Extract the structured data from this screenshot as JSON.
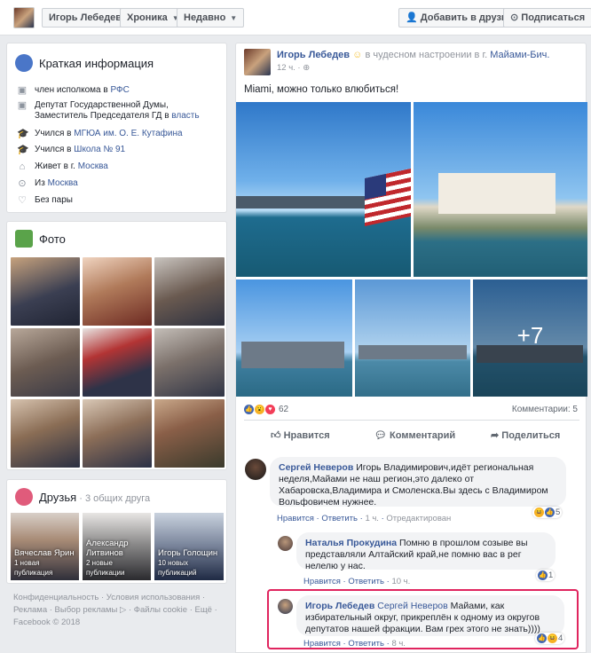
{
  "topbar": {
    "name": "Игорь Лебедев",
    "timeline": "Хроника",
    "recent": "Недавно",
    "add_friend": "Добавить в друзья",
    "subscribe": "Подписаться"
  },
  "intro": {
    "title": "Краткая информация",
    "rows": [
      {
        "icon": "briefcase-icon",
        "text": "член исполкома в",
        "link": "РФС"
      },
      {
        "icon": "briefcase-icon",
        "text": "Депутат Государственной Думы, Заместитель Председателя ГД в",
        "link": "власть"
      },
      {
        "icon": "graduation-cap-icon",
        "text": "Учился в",
        "link": "МГЮА им. О. Е. Кутафина"
      },
      {
        "icon": "graduation-cap-icon",
        "text": "Учился в",
        "link": "Школа № 91"
      },
      {
        "icon": "home-icon",
        "text": "Живет в г.",
        "link": "Москва"
      },
      {
        "icon": "location-pin-icon",
        "text": "Из",
        "link": "Москва"
      },
      {
        "icon": "heart-icon",
        "text": "Без пары",
        "link": ""
      }
    ]
  },
  "photos": {
    "title": "Фото"
  },
  "friends": {
    "title": "Друзья",
    "mutual": "3 общих друга",
    "items": [
      {
        "name": "Вячеслав Ярин",
        "meta": "1 новая публикация"
      },
      {
        "name": "Александр Литвинов",
        "meta": "2 новые публикации"
      },
      {
        "name": "Игорь Голощин",
        "meta": "10 новых публикаций"
      }
    ]
  },
  "footer": {
    "line1": "Конфиденциальность · Условия использования ·",
    "line2": "Реклама · Выбор рекламы ▷ · Файлы cookie · Ещё ·",
    "line3": "Facebook © 2018"
  },
  "post": {
    "author": "Игорь Лебедев",
    "feeling": "в чудесном настроении в г.",
    "place": "Майами-Бич.",
    "time": "12 ч.",
    "text": "Miami, можно только влюбиться!",
    "more_photos": "+7",
    "reactions_count": "62",
    "comments_count": "Комментарии: 5",
    "like": "Нравится",
    "comment": "Комментарий",
    "share": "Поделиться"
  },
  "comments": [
    {
      "author": "Сергей Неверов",
      "text": "Игорь Владимирович,идёт региональная неделя,Майами не наш регион,это далеко от Хабаровска,Владимира и Смоленска.Вы здесь с Владимиром Вольфовичем нужнее.",
      "like": "Нравится",
      "reply": "Ответить",
      "time": "1 ч.",
      "edited": "Отредактирован",
      "reactions": "5"
    },
    {
      "author": "Наталья Прокудина",
      "text": "Помню в прошлом созыве вы представляли Алтайский край,не помню вас в рег нелелю у нас.",
      "like": "Нравится",
      "reply": "Ответить",
      "time": "10 ч.",
      "reactions": "1"
    },
    {
      "author": "Игорь Лебедев",
      "mention": "Сергей Неверов",
      "text": "Майами, как избирательный округ, прикреплён к одному из округов депутатов нашей фракции. Вам грех этого не знать))))",
      "like": "Нравится",
      "reply": "Ответить",
      "time": "8 ч.",
      "reactions": "4"
    }
  ],
  "colors": {
    "link": "#385898",
    "highlight": "#e0245e",
    "background": "#e9ebee"
  }
}
